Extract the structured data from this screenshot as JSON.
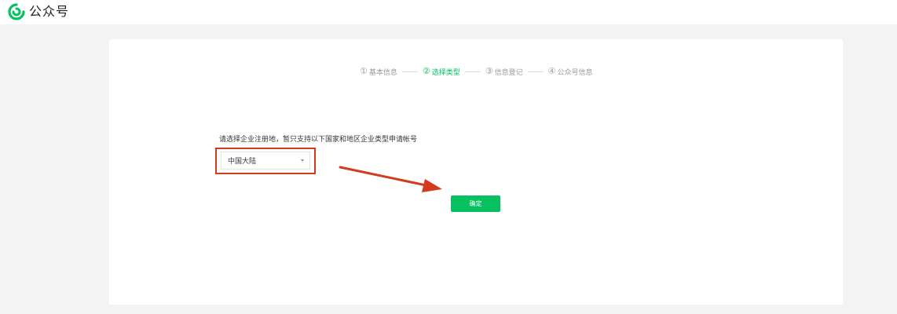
{
  "header": {
    "brand_name": "公众号",
    "logo_icon": "wechat-official-account-logo-icon",
    "brand_color": "#07c160"
  },
  "steps": [
    {
      "number": "①",
      "label": "基本信息",
      "active": false
    },
    {
      "number": "②",
      "label": "选择类型",
      "active": true
    },
    {
      "number": "③",
      "label": "信息登记",
      "active": false
    },
    {
      "number": "④",
      "label": "公众号信息",
      "active": false
    }
  ],
  "form": {
    "prompt": "请选择企业注册地，暂只支持以下国家和地区企业类型申请帐号",
    "region_select": {
      "value": "中国大陆",
      "caret_icon": "caret-down-icon"
    },
    "confirm_label": "确定"
  },
  "annotation": {
    "highlight_color": "#d33a1f",
    "arrow_icon": "red-arrow-icon"
  },
  "colors": {
    "accent": "#07c160",
    "page_background": "#f3f3f3",
    "step_inactive": "#9a9a9a"
  }
}
